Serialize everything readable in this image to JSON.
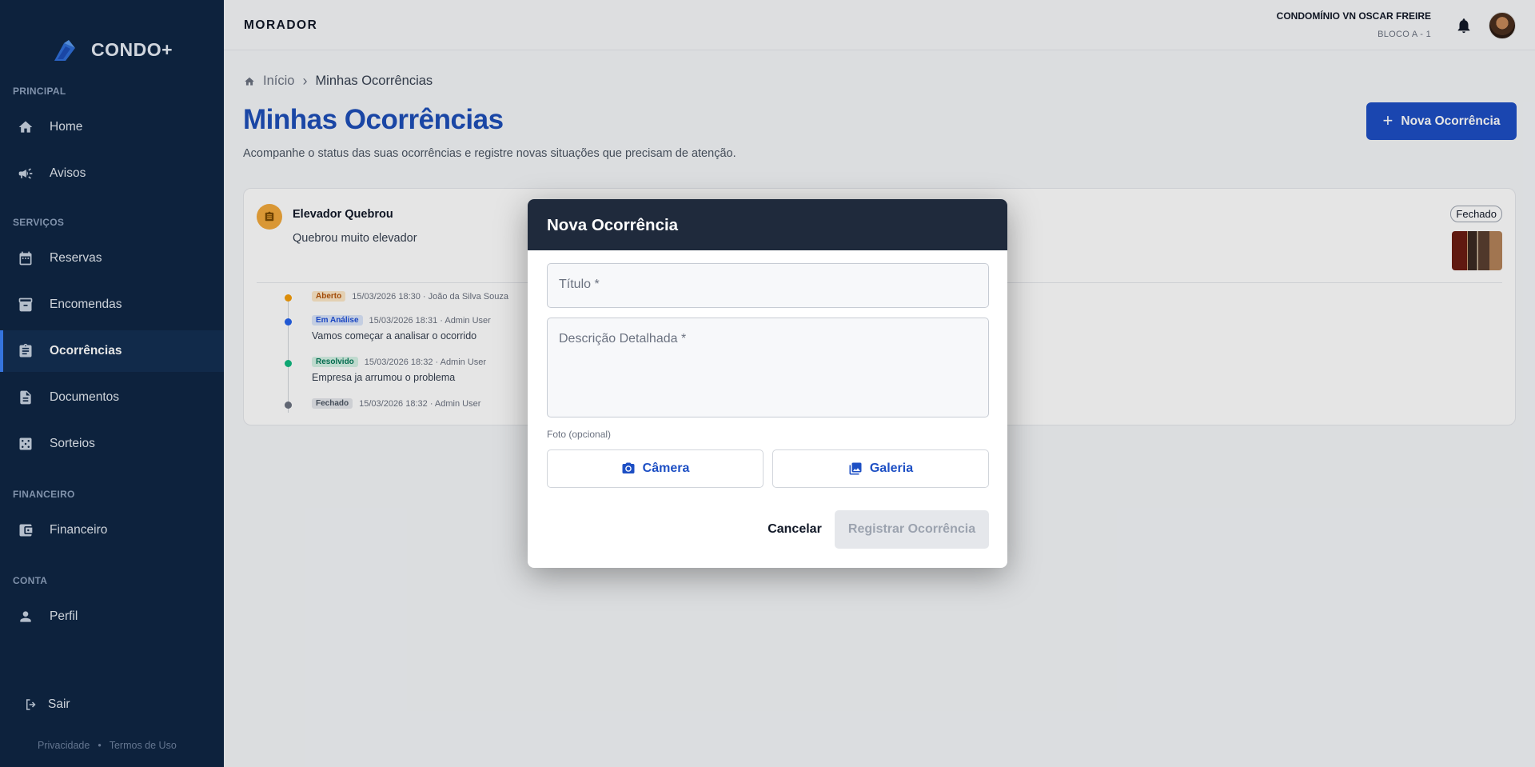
{
  "app": {
    "brand": "CONDO+"
  },
  "sidebar": {
    "sections": [
      {
        "label": "PRINCIPAL"
      },
      {
        "label": "SERVIÇOS"
      },
      {
        "label": "FINANCEIRO"
      },
      {
        "label": "CONTA"
      }
    ],
    "items": [
      {
        "label": "Home",
        "icon": "home-icon"
      },
      {
        "label": "Avisos",
        "icon": "megaphone-icon"
      },
      {
        "label": "Reservas",
        "icon": "calendar-icon"
      },
      {
        "label": "Encomendas",
        "icon": "archive-box-icon"
      },
      {
        "label": "Ocorrências",
        "icon": "clipboard-icon",
        "active": true
      },
      {
        "label": "Documentos",
        "icon": "document-icon"
      },
      {
        "label": "Sorteios",
        "icon": "dice-icon"
      },
      {
        "label": "Financeiro",
        "icon": "wallet-icon"
      },
      {
        "label": "Perfil",
        "icon": "person-icon"
      }
    ],
    "logout": "Sair",
    "privacy": "Privacidade",
    "separator": "•",
    "terms": "Termos de Uso"
  },
  "topbar": {
    "title": "MORADOR",
    "condo_name": "CONDOMÍNIO VN OSCAR FREIRE",
    "unit": "BLOCO A - 1"
  },
  "breadcrumb": {
    "home": "Início",
    "separator": "›",
    "current": "Minhas Ocorrências"
  },
  "page": {
    "title": "Minhas Ocorrências",
    "subtitle": "Acompanhe o status das suas ocorrências e registre novas situações que precisam de atenção.",
    "new_button_icon": "+",
    "new_button": "Nova Ocorrência"
  },
  "occurrence": {
    "title": "Elevador Quebrou",
    "description": "Quebrou muito elevador",
    "status": "Fechado",
    "timeline": [
      {
        "status": "Aberto",
        "meta": "15/03/2026 18:30 · João da Silva Souza",
        "note": "",
        "color": "#f59e0b",
        "badge_bg": "#fde8c8",
        "badge_fg": "#b45309"
      },
      {
        "status": "Em Análise",
        "meta": "15/03/2026 18:31 · Admin User",
        "note": "Vamos começar a analisar o ocorrido",
        "color": "#2563eb",
        "badge_bg": "#dbe6fb",
        "badge_fg": "#1d4ed8"
      },
      {
        "status": "Resolvido",
        "meta": "15/03/2026 18:32 · Admin User",
        "note": "Empresa ja arrumou o problema",
        "color": "#10b981",
        "badge_bg": "#d5f3e6",
        "badge_fg": "#047857"
      },
      {
        "status": "Fechado",
        "meta": "15/03/2026 18:32 · Admin User",
        "note": "",
        "color": "#6b7280",
        "badge_bg": "#e5e7eb",
        "badge_fg": "#4b5563"
      }
    ]
  },
  "modal": {
    "title": "Nova Ocorrência",
    "title_placeholder": "Título *",
    "description_placeholder": "Descrição Detalhada *",
    "photo_label": "Foto (opcional)",
    "camera": "Câmera",
    "gallery": "Galeria",
    "cancel": "Cancelar",
    "submit": "Registrar Ocorrência"
  }
}
